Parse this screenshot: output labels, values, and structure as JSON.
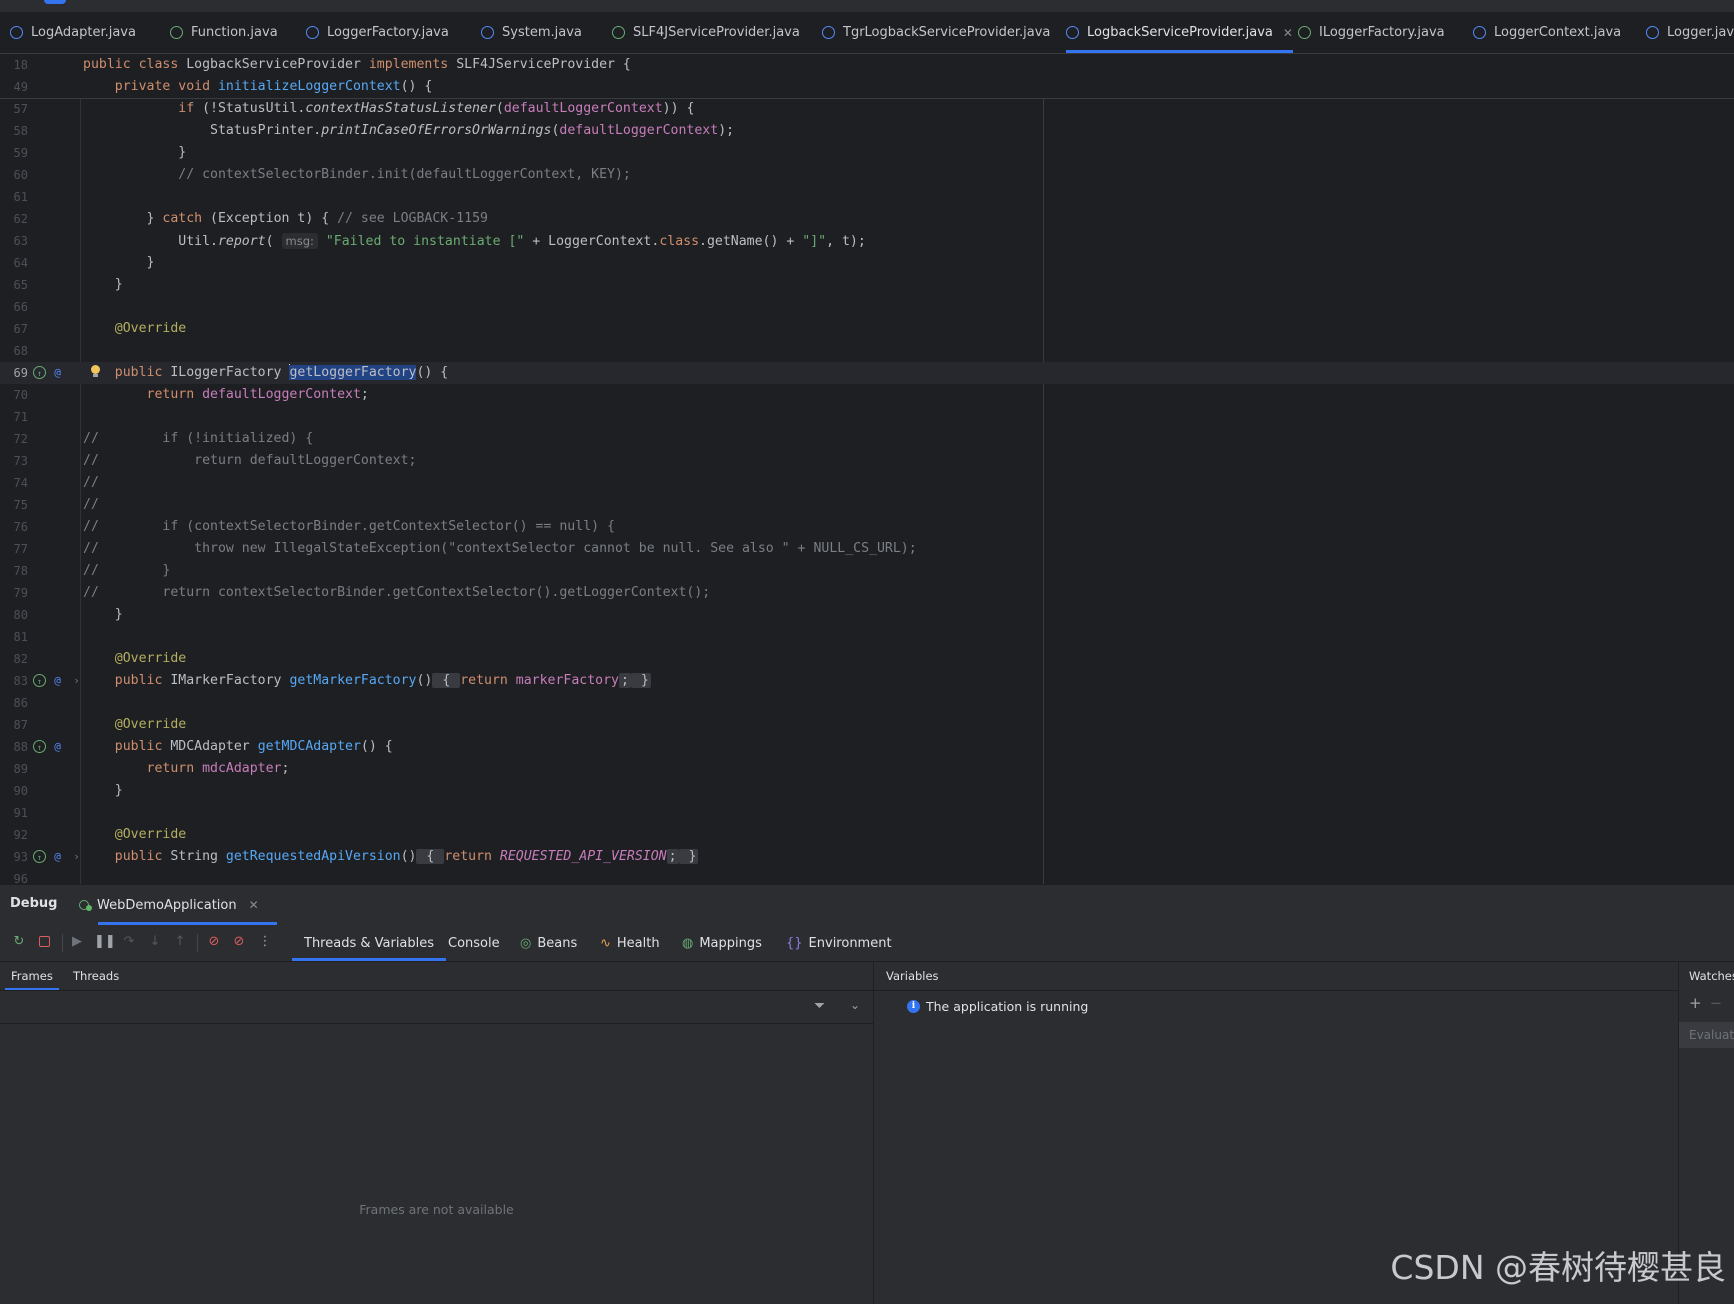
{
  "tabs": [
    {
      "label": "LogAdapter.java",
      "kind": "class"
    },
    {
      "label": "Function.java",
      "kind": "interface"
    },
    {
      "label": "LoggerFactory.java",
      "kind": "class"
    },
    {
      "label": "System.java",
      "kind": "class"
    },
    {
      "label": "SLF4JServiceProvider.java",
      "kind": "interface"
    },
    {
      "label": "TgrLogbackServiceProvider.java",
      "kind": "class"
    },
    {
      "label": "LogbackServiceProvider.java",
      "kind": "class",
      "active": true
    },
    {
      "label": "ILoggerFactory.java",
      "kind": "interface"
    },
    {
      "label": "LoggerContext.java",
      "kind": "class"
    },
    {
      "label": "Logger.java",
      "kind": "class"
    }
  ],
  "sticky": [
    {
      "n": "18",
      "segs": [
        [
          "k",
          "public class "
        ],
        [
          "",
          "LogbackServiceProvider "
        ],
        [
          "k",
          "implements "
        ],
        [
          "",
          "SLF4JServiceProvider {"
        ]
      ]
    },
    {
      "n": "49",
      "segs": [
        [
          "k",
          "    private void "
        ],
        [
          "f",
          "initializeLoggerContext"
        ],
        [
          "",
          "() {"
        ]
      ]
    }
  ],
  "lines": [
    {
      "n": "57",
      "segs": [
        [
          "",
          "            "
        ],
        [
          "k",
          "if "
        ],
        [
          "",
          "(!StatusUtil."
        ],
        [
          "it",
          "contextHasStatusListener"
        ],
        [
          "",
          "("
        ],
        [
          "fi",
          "defaultLoggerContext"
        ],
        [
          "",
          ")) {"
        ]
      ]
    },
    {
      "n": "58",
      "segs": [
        [
          "",
          "                StatusPrinter."
        ],
        [
          "it",
          "printInCaseOfErrorsOrWarnings"
        ],
        [
          "",
          "("
        ],
        [
          "fi",
          "defaultLoggerContext"
        ],
        [
          "",
          ");"
        ]
      ]
    },
    {
      "n": "59",
      "segs": [
        [
          "",
          "            }"
        ]
      ]
    },
    {
      "n": "60",
      "segs": [
        [
          "c",
          "            // contextSelectorBinder.init(defaultLoggerContext, KEY);"
        ]
      ]
    },
    {
      "n": "61",
      "segs": []
    },
    {
      "n": "62",
      "segs": [
        [
          "",
          "        } "
        ],
        [
          "k",
          "catch "
        ],
        [
          "",
          "(Exception t) { "
        ],
        [
          "c",
          "// see LOGBACK-1159"
        ]
      ]
    },
    {
      "n": "63",
      "segs": [
        [
          "",
          "            Util."
        ],
        [
          "it",
          "report"
        ],
        [
          "",
          "( "
        ],
        [
          "hint",
          "msg:"
        ],
        [
          "",
          " "
        ],
        [
          "s",
          "\"Failed to instantiate [\" "
        ],
        [
          "",
          "+ LoggerContext."
        ],
        [
          "k",
          "class"
        ],
        [
          "",
          ".getName() + "
        ],
        [
          "s",
          "\"]\""
        ],
        [
          "",
          ", t);"
        ]
      ]
    },
    {
      "n": "64",
      "segs": [
        [
          "",
          "        }"
        ]
      ]
    },
    {
      "n": "65",
      "segs": [
        [
          "",
          "    }"
        ]
      ]
    },
    {
      "n": "66",
      "segs": []
    },
    {
      "n": "67",
      "segs": [
        [
          "a",
          "    @Override"
        ]
      ]
    },
    {
      "n": "68",
      "segs": []
    },
    {
      "n": "69",
      "cur": true,
      "segs": [
        [
          "k",
          "    public "
        ],
        [
          "",
          "ILoggerFactory "
        ],
        [
          "caret",
          ""
        ],
        [
          "sel",
          "getLoggerFactory"
        ],
        [
          "",
          "() {"
        ]
      ]
    },
    {
      "n": "70",
      "segs": [
        [
          "k",
          "        return "
        ],
        [
          "fi",
          "defaultLoggerContext"
        ],
        [
          "",
          ";"
        ]
      ]
    },
    {
      "n": "71",
      "segs": []
    },
    {
      "n": "72",
      "segs": [
        [
          "c",
          "//        if (!initialized) {"
        ]
      ]
    },
    {
      "n": "73",
      "segs": [
        [
          "c",
          "//            return defaultLoggerContext;"
        ]
      ]
    },
    {
      "n": "74",
      "segs": [
        [
          "c",
          "//"
        ]
      ]
    },
    {
      "n": "75",
      "segs": [
        [
          "c",
          "//"
        ]
      ]
    },
    {
      "n": "76",
      "segs": [
        [
          "c",
          "//        if (contextSelectorBinder.getContextSelector() == null) {"
        ]
      ]
    },
    {
      "n": "77",
      "segs": [
        [
          "c",
          "//            throw new IllegalStateException(\"contextSelector cannot be null. See also \" + NULL_CS_URL);"
        ]
      ]
    },
    {
      "n": "78",
      "segs": [
        [
          "c",
          "//        }"
        ]
      ]
    },
    {
      "n": "79",
      "segs": [
        [
          "c",
          "//        return contextSelectorBinder.getContextSelector().getLoggerContext();"
        ]
      ]
    },
    {
      "n": "80",
      "segs": [
        [
          "",
          "    }"
        ]
      ]
    },
    {
      "n": "81",
      "segs": []
    },
    {
      "n": "82",
      "segs": [
        [
          "a",
          "    @Override"
        ]
      ]
    },
    {
      "n": "83",
      "segs": [
        [
          "k",
          "    public "
        ],
        [
          "",
          "IMarkerFactory "
        ],
        [
          "f",
          "getMarkerFactory"
        ],
        [
          "",
          "()"
        ],
        [
          "fold",
          " { "
        ],
        [
          "k",
          "return "
        ],
        [
          "fi",
          "markerFactory"
        ],
        [
          "fold",
          ";"
        ],
        [
          "fold",
          " }"
        ]
      ]
    },
    {
      "n": "86",
      "segs": []
    },
    {
      "n": "87",
      "segs": [
        [
          "a",
          "    @Override"
        ]
      ]
    },
    {
      "n": "88",
      "segs": [
        [
          "k",
          "    public "
        ],
        [
          "",
          "MDCAdapter "
        ],
        [
          "f",
          "getMDCAdapter"
        ],
        [
          "",
          "() {"
        ]
      ]
    },
    {
      "n": "89",
      "segs": [
        [
          "k",
          "        return "
        ],
        [
          "fi",
          "mdcAdapter"
        ],
        [
          "",
          ";"
        ]
      ]
    },
    {
      "n": "90",
      "segs": [
        [
          "",
          "    }"
        ]
      ]
    },
    {
      "n": "91",
      "segs": []
    },
    {
      "n": "92",
      "segs": [
        [
          "a",
          "    @Override"
        ]
      ]
    },
    {
      "n": "93",
      "segs": [
        [
          "k",
          "    public "
        ],
        [
          "",
          "String "
        ],
        [
          "f",
          "getRequestedApiVersion"
        ],
        [
          "",
          "()"
        ],
        [
          "fold",
          " { "
        ],
        [
          "k",
          "return "
        ],
        [
          "cn",
          "REQUESTED_API_VERSION"
        ],
        [
          "fold",
          ";"
        ],
        [
          "fold",
          " }"
        ]
      ]
    },
    {
      "n": "96",
      "segs": []
    }
  ],
  "debug": {
    "title": "Debug",
    "run_config": "WebDemoApplication",
    "tabs": [
      "Threads & Variables",
      "Console",
      "Beans",
      "Health",
      "Mappings",
      "Environment"
    ],
    "frames_tab": "Frames",
    "threads_tab": "Threads",
    "frames_empty": "Frames are not available",
    "variables_title": "Variables",
    "variables_msg": "The application is running",
    "watches_title": "Watches",
    "evaluate_placeholder": "Evaluate"
  },
  "watermark": "CSDN @春树待樱甚良"
}
